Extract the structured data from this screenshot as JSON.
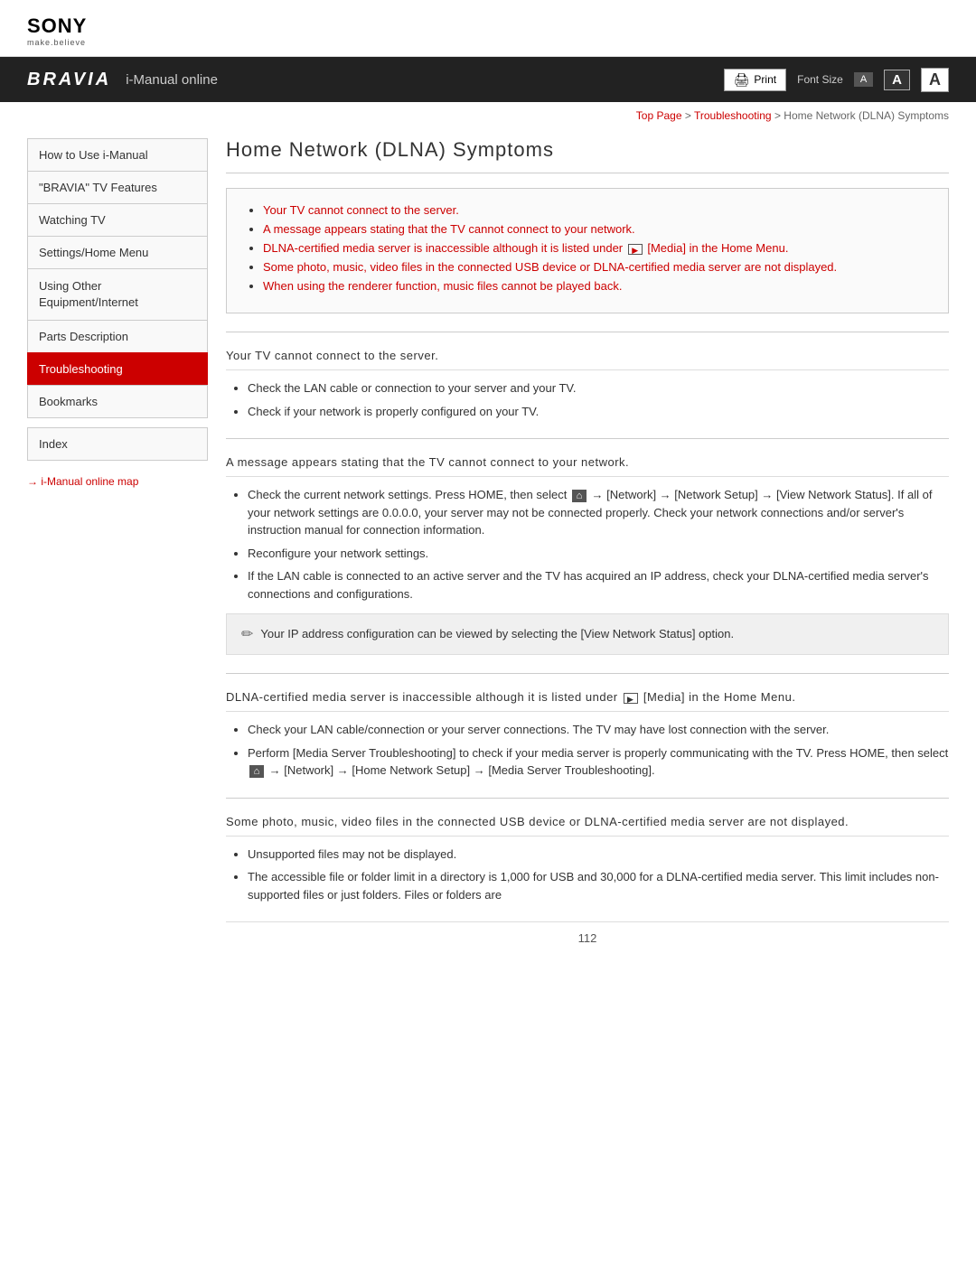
{
  "header": {
    "sony_logo": "SONY",
    "sony_tagline": "make.believe"
  },
  "navbar": {
    "bravia_logo": "BRAVIA",
    "imanual_title": "i-Manual online",
    "print_label": "Print",
    "font_size_label": "Font Size",
    "font_small": "A",
    "font_medium": "A",
    "font_large": "A"
  },
  "breadcrumb": {
    "top_page": "Top Page",
    "separator1": " > ",
    "troubleshooting": "Troubleshooting",
    "separator2": " > ",
    "current": "Home Network (DLNA) Symptoms"
  },
  "sidebar": {
    "items": [
      {
        "label": "How to Use i-Manual",
        "active": false
      },
      {
        "label": "\"BRAVIA\" TV Features",
        "active": false
      },
      {
        "label": "Watching TV",
        "active": false
      },
      {
        "label": "Settings/Home Menu",
        "active": false
      },
      {
        "label": "Using Other Equipment/Internet",
        "active": false
      },
      {
        "label": "Parts Description",
        "active": false
      },
      {
        "label": "Troubleshooting",
        "active": true
      },
      {
        "label": "Bookmarks",
        "active": false
      }
    ],
    "index_label": "Index",
    "map_link": "→ i-Manual online map"
  },
  "content": {
    "page_title": "Home Network (DLNA) Symptoms",
    "summary_links": [
      "Your TV cannot connect to the server.",
      "A message appears stating that the TV cannot connect to your network.",
      "DLNA-certified media server is inaccessible although it is listed under [Media] in the Home Menu.",
      "Some photo, music, video files in the connected USB device or DLNA-certified media server are not displayed.",
      "When using the renderer function, music files cannot be played back."
    ],
    "section1": {
      "title": "Your TV cannot connect to the server.",
      "bullets": [
        "Check the LAN cable or connection to your server and your TV.",
        "Check if your network is properly configured on your TV."
      ]
    },
    "section2": {
      "title": "A message appears stating that the TV cannot connect to your network.",
      "bullets": [
        "Check the current network settings. Press HOME, then select  → [Network] → [Network Setup] → [View Network Status]. If all of your network settings are 0.0.0.0, your server may not be connected properly. Check your network connections and/or server's instruction manual for connection information.",
        "Reconfigure your network settings.",
        "If the LAN cable is connected to an active server and the TV has acquired an IP address, check your DLNA-certified media server's connections and configurations."
      ],
      "note": "Your IP address configuration can be viewed by selecting the [View Network Status] option."
    },
    "section3": {
      "title": "DLNA-certified media server is inaccessible although it is listed under [Media] in the Home Menu.",
      "bullets": [
        "Check your LAN cable/connection or your server connections. The TV may have lost connection with the server.",
        "Perform [Media Server Troubleshooting] to check if your media server is properly communicating with the TV. Press HOME, then select  → [Network] → [Home Network Setup] → [Media Server Troubleshooting]."
      ]
    },
    "section4": {
      "title": "Some photo, music, video files in the connected USB device or DLNA-certified media server are not displayed.",
      "bullets": [
        "Unsupported files may not be displayed.",
        "The accessible file or folder limit in a directory is 1,000 for USB and 30,000 for a DLNA-certified media server. This limit includes non-supported files or just folders. Files or folders are"
      ]
    },
    "page_number": "112"
  }
}
